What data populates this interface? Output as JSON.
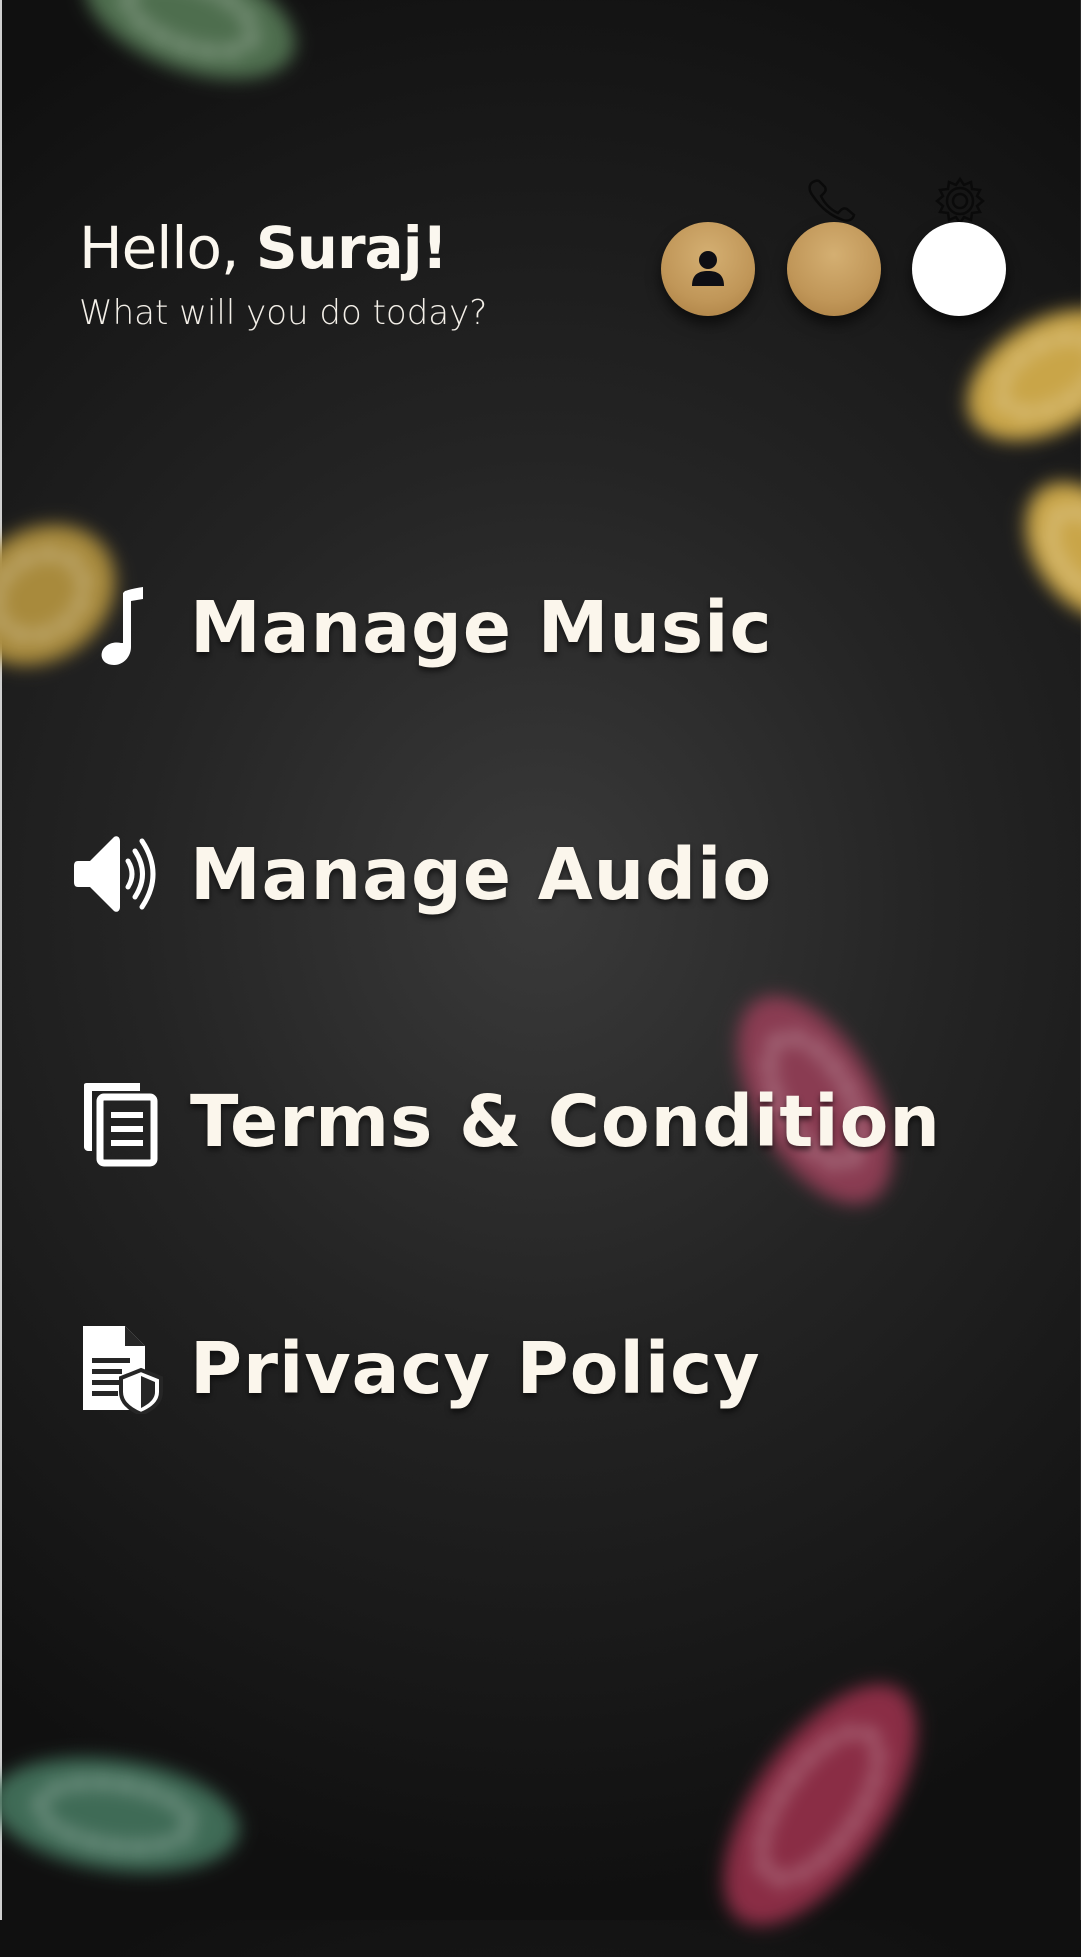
{
  "greeting": {
    "hello_prefix": "Hello, ",
    "user_name": "Suraj!",
    "subtitle": "What will you do today?"
  },
  "header_icons": [
    {
      "icon": "user-icon",
      "color": "#c09658"
    },
    {
      "icon": "phone-icon",
      "color": "#c09658"
    },
    {
      "icon": "gear-icon",
      "color": "#ffffff"
    }
  ],
  "menu": {
    "items": [
      {
        "label": "Manage Music",
        "icon": "music-note-icon"
      },
      {
        "label": "Manage Audio",
        "icon": "speaker-icon"
      },
      {
        "label": "Terms & Condition",
        "icon": "documents-icon"
      },
      {
        "label": "Privacy Policy",
        "icon": "privacy-document-icon"
      }
    ]
  },
  "colors": {
    "accent_gold": "#c09658",
    "text": "#fbf6ec",
    "background": "#242424"
  }
}
